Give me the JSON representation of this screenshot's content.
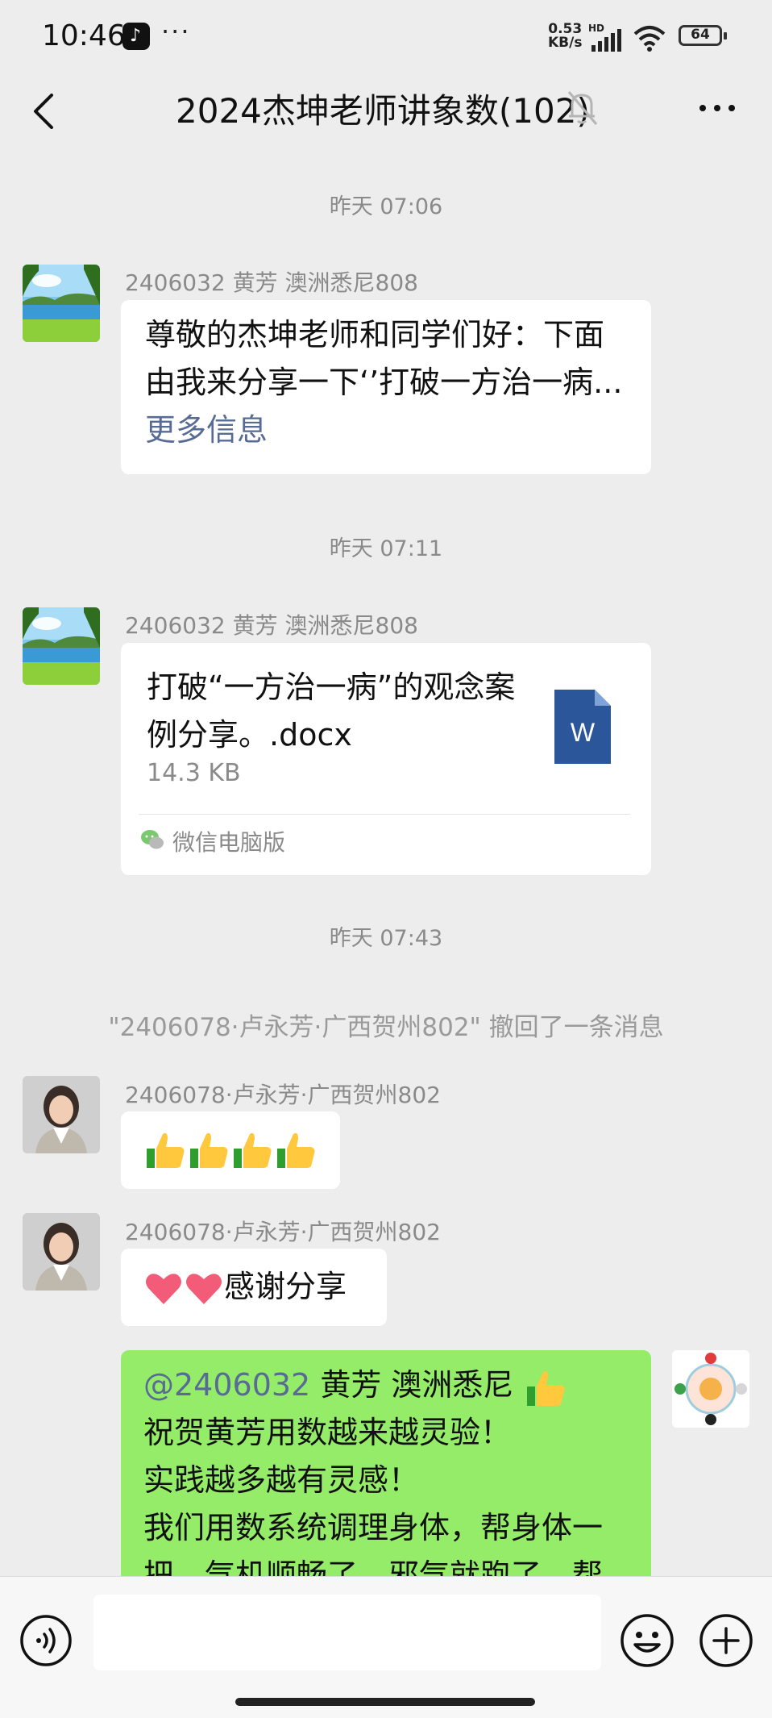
{
  "status_bar": {
    "time": "10:46",
    "app_icon": "tiktok-icon",
    "dots": "···",
    "net_speed_value": "0.53",
    "net_speed_unit": "KB/s",
    "network_label": "HD",
    "battery": "64"
  },
  "nav": {
    "title": "2024杰坤老师讲象数(102)",
    "icons": [
      "back-chevron-icon",
      "mute-bell-icon",
      "more-icon"
    ]
  },
  "messages": {
    "ts1": "昨天 07:06",
    "m1_sender": "2406032  黄芳    澳洲悉尼808",
    "m1_text": "尊敬的杰坤老师和同学们好：下面由我来分享一下‘’打破一方治一病...",
    "m1_more": "更多信息",
    "ts2": "昨天 07:11",
    "m2_sender": "2406032  黄芳    澳洲悉尼808",
    "m2_file_name": "打破“一方治一病”的观念案例分享。.docx",
    "m2_file_size": "14.3 KB",
    "m2_file_icon_letter": "W",
    "m2_source": "微信电脑版",
    "ts3": "昨天 07:43",
    "recall_notice": "\"2406078·卢永芳·广西贺州802\" 撤回了一条消息",
    "m3_sender": "2406078·卢永芳·广西贺州802",
    "m3_emoji": [
      "thumbs-up",
      "thumbs-up",
      "thumbs-up",
      "thumbs-up"
    ],
    "m4_sender": "2406078·卢永芳·广西贺州802",
    "m4_text": "感谢分享",
    "m5_mention": "@2406032",
    "m5_line1_rest": "  黄芳    澳洲悉尼 ",
    "m5_line2": "祝贺黄芳用数越来越灵验！",
    "m5_line3": "实践越多越有灵感！",
    "m5_line4": "我们用数系统调理身体，帮身体一",
    "m5_line5": "把，气机顺畅了，邪气就跑了，帮"
  },
  "input": {
    "placeholder": ""
  },
  "colors": {
    "background": "#ededed",
    "bubble_received": "#ffffff",
    "bubble_sent": "#95ec69",
    "link": "#576b95",
    "word_blue": "#2b579a"
  }
}
